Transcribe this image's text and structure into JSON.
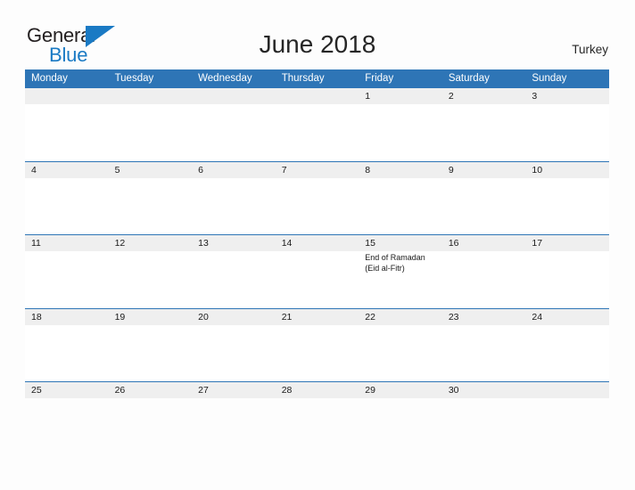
{
  "brand": {
    "name_part1": "General",
    "name_part2": "Blue",
    "flag_icon": "blue-triangle-flag",
    "color_dark": "#231f20",
    "color_blue": "#1a7ac4"
  },
  "header": {
    "title": "June 2018",
    "country": "Turkey"
  },
  "calendar": {
    "accent_color": "#2e75b6",
    "daynum_band_color": "#efefef",
    "weekday_headers": [
      "Monday",
      "Tuesday",
      "Wednesday",
      "Thursday",
      "Friday",
      "Saturday",
      "Sunday"
    ],
    "weeks": [
      {
        "days": [
          {
            "num": "",
            "events": ""
          },
          {
            "num": "",
            "events": ""
          },
          {
            "num": "",
            "events": ""
          },
          {
            "num": "",
            "events": ""
          },
          {
            "num": "1",
            "events": ""
          },
          {
            "num": "2",
            "events": ""
          },
          {
            "num": "3",
            "events": ""
          }
        ]
      },
      {
        "days": [
          {
            "num": "4",
            "events": ""
          },
          {
            "num": "5",
            "events": ""
          },
          {
            "num": "6",
            "events": ""
          },
          {
            "num": "7",
            "events": ""
          },
          {
            "num": "8",
            "events": ""
          },
          {
            "num": "9",
            "events": ""
          },
          {
            "num": "10",
            "events": ""
          }
        ]
      },
      {
        "days": [
          {
            "num": "11",
            "events": ""
          },
          {
            "num": "12",
            "events": ""
          },
          {
            "num": "13",
            "events": ""
          },
          {
            "num": "14",
            "events": ""
          },
          {
            "num": "15",
            "events": "End of Ramadan\n(Eid al-Fitr)"
          },
          {
            "num": "16",
            "events": ""
          },
          {
            "num": "17",
            "events": ""
          }
        ]
      },
      {
        "days": [
          {
            "num": "18",
            "events": ""
          },
          {
            "num": "19",
            "events": ""
          },
          {
            "num": "20",
            "events": ""
          },
          {
            "num": "21",
            "events": ""
          },
          {
            "num": "22",
            "events": ""
          },
          {
            "num": "23",
            "events": ""
          },
          {
            "num": "24",
            "events": ""
          }
        ]
      },
      {
        "days": [
          {
            "num": "25",
            "events": ""
          },
          {
            "num": "26",
            "events": ""
          },
          {
            "num": "27",
            "events": ""
          },
          {
            "num": "28",
            "events": ""
          },
          {
            "num": "29",
            "events": ""
          },
          {
            "num": "30",
            "events": ""
          },
          {
            "num": "",
            "events": ""
          }
        ]
      }
    ]
  }
}
